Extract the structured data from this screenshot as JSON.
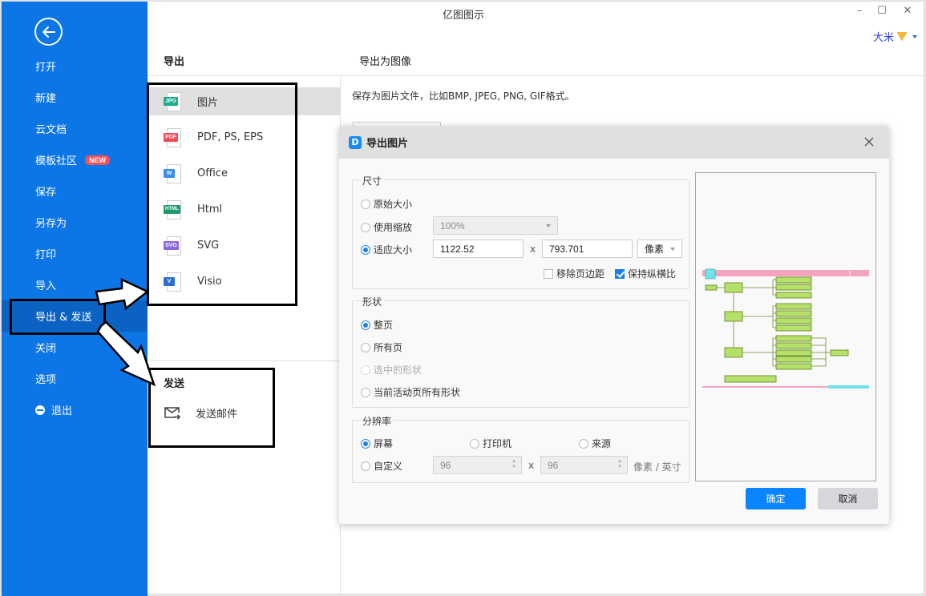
{
  "app": {
    "title": "亿图图示",
    "user_name": "大米",
    "window_controls": {
      "minimize": "–",
      "maximize": "☐",
      "close": "✕"
    }
  },
  "sidebar": {
    "back_icon": "arrow-left-circle-icon",
    "items": [
      {
        "label": "打开"
      },
      {
        "label": "新建"
      },
      {
        "label": "云文档"
      },
      {
        "label": "模板社区",
        "badge": "NEW"
      },
      {
        "label": "保存"
      },
      {
        "label": "另存为"
      },
      {
        "label": "打印"
      },
      {
        "label": "导入"
      },
      {
        "label": "导出 & 发送",
        "active": true
      },
      {
        "label": "关闭"
      },
      {
        "label": "选项"
      },
      {
        "label": "退出",
        "icon": "minus-circle-icon"
      }
    ]
  },
  "export_panel": {
    "heading": "导出",
    "formats": [
      {
        "tag": "JPG",
        "label": "图片",
        "color": "#1aaa8c",
        "active": true
      },
      {
        "tag": "PDF",
        "label": "PDF, PS, EPS",
        "color": "#f24a55"
      },
      {
        "tag": "W",
        "label": "Office",
        "color": "#3a8ef0"
      },
      {
        "tag": "HTML",
        "label": "Html",
        "color": "#1f9a6a"
      },
      {
        "tag": "SVG",
        "label": "SVG",
        "color": "#8a66dd"
      },
      {
        "tag": "V",
        "label": "Visio",
        "color": "#2e6fd6"
      }
    ],
    "send_heading": "发送",
    "send_items": [
      {
        "label": "发送邮件",
        "icon": "mail-send-icon"
      }
    ]
  },
  "detail": {
    "heading": "导出为图像",
    "description": "保存为图片文件，比如BMP, JPEG, PNG, GIF格式。"
  },
  "dialog": {
    "title": "导出图片",
    "size_group": {
      "label": "尺寸",
      "options": [
        {
          "label": "原始大小",
          "selected": false
        },
        {
          "label": "使用缩放",
          "selected": false
        },
        {
          "label": "适应大小",
          "selected": true
        }
      ],
      "zoom_value": "100%",
      "width": "1122.52",
      "height": "793.701",
      "x_sep": "x",
      "unit": "像素",
      "remove_margin": {
        "label": "移除页边距",
        "checked": false
      },
      "keep_ratio": {
        "label": "保持纵横比",
        "checked": true
      }
    },
    "shape_group": {
      "label": "形状",
      "options": [
        {
          "label": "整页",
          "selected": true,
          "disabled": false
        },
        {
          "label": "所有页",
          "selected": false,
          "disabled": false
        },
        {
          "label": "选中的形状",
          "selected": false,
          "disabled": true
        },
        {
          "label": "当前活动页所有形状",
          "selected": false,
          "disabled": false
        }
      ]
    },
    "resolution_group": {
      "label": "分辨率",
      "options": [
        {
          "label": "屏幕",
          "selected": true
        },
        {
          "label": "打印机",
          "selected": false
        },
        {
          "label": "来源",
          "selected": false
        },
        {
          "label": "自定义",
          "selected": false
        }
      ],
      "dpi_x": "96",
      "dpi_y": "96",
      "x_sep": "x",
      "unit": "像素 / 英寸"
    },
    "ok_label": "确定",
    "cancel_label": "取消"
  },
  "colors": {
    "sidebar_bg": "#0c76e7",
    "sidebar_active": "#0b62c2",
    "primary_button": "#0a84ff",
    "new_badge": "#f5525a"
  }
}
